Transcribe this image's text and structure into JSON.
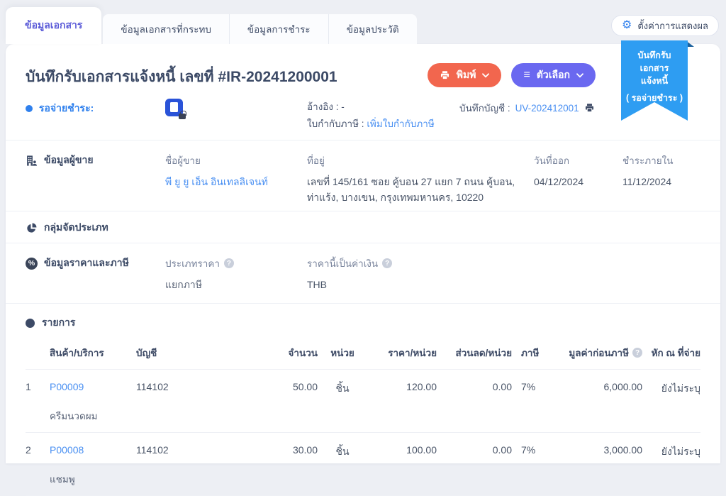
{
  "tabs": [
    {
      "label": "ข้อมูลเอกสาร",
      "active": true
    },
    {
      "label": "ข้อมูลเอกสารที่กระทบ",
      "active": false
    },
    {
      "label": "ข้อมูลการชำระ",
      "active": false
    },
    {
      "label": "ข้อมูลประวัติ",
      "active": false
    }
  ],
  "settings_button": {
    "label": "ตั้งค่าการแสดงผล"
  },
  "ribbon": {
    "line1": "บันทึกรับเอกสาร",
    "line2": "แจ้งหนี้",
    "line3": "( รอจ่ายชำระ )"
  },
  "document": {
    "title": "บันทึกรับเอกสารแจ้งหนี้ เลขที่ #IR-20241200001",
    "print_button": "พิมพ์",
    "options_button": "ตัวเลือก",
    "status": "รอจ่ายชำระ:",
    "reference_label": "อ้างอิง :",
    "reference_value": "-",
    "tax_invoice_label": "ใบกำกับภาษี :",
    "tax_invoice_link": "เพิ่มใบกำกับภาษี",
    "ledger_label": "บันทึกบัญชี :",
    "ledger_value": "UV-202412001"
  },
  "seller": {
    "section_title": "ข้อมูลผู้ขาย",
    "name_label": "ชื่อผู้ขาย",
    "name_value": "พี ยู ยู เอ็น อินเทลลิเจนท์",
    "address_label": "ที่อยู่",
    "address_value": "เลขที่ 145/161 ซอย คู้บอน 27 แยก 7 ถนน คู้บอน, ท่าแร้ง, บางเขน, กรุงเทพมหานคร, 10220",
    "issue_date_label": "วันที่ออก",
    "issue_date_value": "04/12/2024",
    "due_label": "ชำระภายใน",
    "due_value": "11/12/2024"
  },
  "classification": {
    "section_title": "กลุ่มจัดประเภท"
  },
  "pricing": {
    "section_title": "ข้อมูลราคาและภาษี",
    "price_type_label": "ประเภทราคา",
    "price_type_value": "แยกภาษี",
    "currency_label": "ราคานี้เป็นค่าเงิน",
    "currency_value": "THB"
  },
  "items": {
    "section_title": "รายการ",
    "columns": [
      "สินค้า/บริการ",
      "บัญชี",
      "จำนวน",
      "หน่วย",
      "ราคา/หน่วย",
      "ส่วนลด/หน่วย",
      "ภาษี",
      "มูลค่าก่อนภาษี",
      "หัก ณ ที่จ่าย"
    ],
    "rows": [
      {
        "no": "1",
        "code": "P00009",
        "name": "ครีมนวดผม",
        "account": "114102",
        "qty": "50.00",
        "unit": "ชิ้น",
        "price": "120.00",
        "discount": "0.00",
        "tax": "7%",
        "pretax": "6,000.00",
        "wht": "ยังไม่ระบุ"
      },
      {
        "no": "2",
        "code": "P00008",
        "name": "แชมพู",
        "account": "114102",
        "qty": "30.00",
        "unit": "ชิ้น",
        "price": "100.00",
        "discount": "0.00",
        "tax": "7%",
        "pretax": "3,000.00",
        "wht": "ยังไม่ระบุ"
      }
    ]
  },
  "colors": {
    "accent_blue": "#2f80ed",
    "accent_indigo": "#5b5bd8",
    "accent_orange": "#f2664e",
    "accent_purple": "#6a68f0",
    "ribbon_blue": "#2e9df2",
    "link_blue": "#4a90f2",
    "text_dark": "#3c4a66"
  }
}
